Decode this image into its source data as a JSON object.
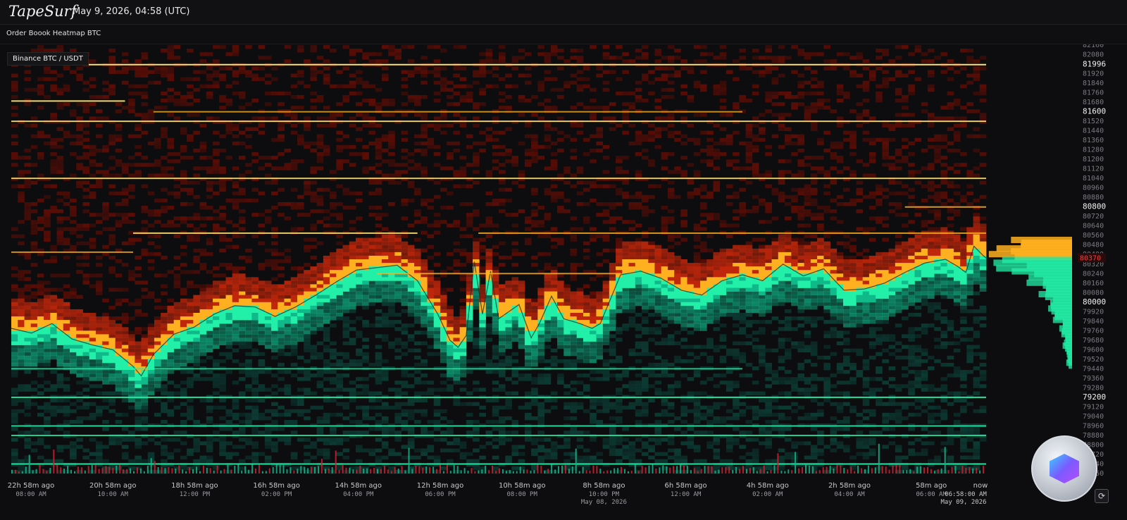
{
  "header": {
    "brand": "TapeSurf",
    "datetime": "May 9, 2026, 04:58 (UTC)"
  },
  "subheader": {
    "title": "Order Boook Heatmap BTC"
  },
  "market_label": "Binance BTC / USDT",
  "icons": {
    "logo": "cube-logo-icon",
    "refresh": "refresh-icon"
  },
  "colors": {
    "background": "#0d0d0f",
    "ask_low": "#5a0d06",
    "ask_mid": "#c0260b",
    "ask_high": "#ffb020",
    "ask_peak": "#ffe070",
    "bid_low": "#0c3b33",
    "bid_mid": "#10b98a",
    "bid_high": "#22f0a8",
    "current_price_marker": "#ff3b3b"
  },
  "chart_data": {
    "type": "heatmap",
    "title": "Order Boook Heatmap BTC",
    "subtitle": "Binance BTC / USDT",
    "y_axis": {
      "ticks": [
        82160,
        82080,
        81996,
        81920,
        81840,
        81760,
        81680,
        81600,
        81520,
        81440,
        81360,
        81280,
        81200,
        81120,
        81040,
        80960,
        80880,
        80800,
        80720,
        80640,
        80560,
        80480,
        80400,
        80320,
        80240,
        80160,
        80080,
        80000,
        79920,
        79840,
        79760,
        79680,
        79600,
        79520,
        79440,
        79360,
        79280,
        79200,
        79120,
        79040,
        78960,
        78880,
        78800,
        78720,
        78640,
        78560
      ],
      "highlighted_ticks": [
        81996,
        81600,
        80800,
        80000,
        79200
      ],
      "current_price_label": "80370",
      "range": [
        78560,
        82160
      ]
    },
    "x_axis": {
      "ticks": [
        {
          "ago": "22h 58m ago",
          "time": "08:00 AM",
          "date": ""
        },
        {
          "ago": "20h 58m ago",
          "time": "10:00 AM",
          "date": ""
        },
        {
          "ago": "18h 58m ago",
          "time": "12:00 PM",
          "date": ""
        },
        {
          "ago": "16h 58m ago",
          "time": "02:00 PM",
          "date": ""
        },
        {
          "ago": "14h 58m ago",
          "time": "04:00 PM",
          "date": ""
        },
        {
          "ago": "12h 58m ago",
          "time": "06:00 PM",
          "date": ""
        },
        {
          "ago": "10h 58m ago",
          "time": "08:00 PM",
          "date": ""
        },
        {
          "ago": "8h 58m ago",
          "time": "10:00 PM",
          "date": "May 08, 2026"
        },
        {
          "ago": "6h 58m ago",
          "time": "12:00 AM",
          "date": ""
        },
        {
          "ago": "4h 58m ago",
          "time": "02:00 AM",
          "date": ""
        },
        {
          "ago": "2h 58m ago",
          "time": "04:00 AM",
          "date": ""
        },
        {
          "ago": "58m ago",
          "time": "06:00 AM",
          "date": ""
        }
      ],
      "now_label": "now",
      "cursor_time": "06:58:00 AM",
      "cursor_date": "May 09, 2026"
    },
    "mid_price_series": [
      {
        "t": -24.0,
        "price": 79780
      },
      {
        "t": -23.5,
        "price": 79740
      },
      {
        "t": -23.0,
        "price": 79820
      },
      {
        "t": -22.5,
        "price": 79690
      },
      {
        "t": -22.0,
        "price": 79640
      },
      {
        "t": -21.5,
        "price": 79600
      },
      {
        "t": -21.0,
        "price": 79460
      },
      {
        "t": -20.8,
        "price": 79380
      },
      {
        "t": -20.5,
        "price": 79560
      },
      {
        "t": -20.0,
        "price": 79730
      },
      {
        "t": -19.5,
        "price": 79790
      },
      {
        "t": -19.0,
        "price": 79900
      },
      {
        "t": -18.5,
        "price": 79970
      },
      {
        "t": -18.0,
        "price": 79960
      },
      {
        "t": -17.5,
        "price": 79880
      },
      {
        "t": -17.0,
        "price": 79960
      },
      {
        "t": -16.5,
        "price": 80060
      },
      {
        "t": -16.0,
        "price": 80170
      },
      {
        "t": -15.5,
        "price": 80270
      },
      {
        "t": -15.0,
        "price": 80290
      },
      {
        "t": -14.5,
        "price": 80310
      },
      {
        "t": -14.0,
        "price": 80180
      },
      {
        "t": -13.5,
        "price": 79900
      },
      {
        "t": -13.2,
        "price": 79680
      },
      {
        "t": -13.0,
        "price": 79620
      },
      {
        "t": -12.8,
        "price": 79720
      },
      {
        "t": -12.6,
        "price": 80340
      },
      {
        "t": -12.4,
        "price": 79900
      },
      {
        "t": -12.2,
        "price": 80260
      },
      {
        "t": -12.0,
        "price": 79860
      },
      {
        "t": -11.5,
        "price": 79980
      },
      {
        "t": -11.2,
        "price": 79700
      },
      {
        "t": -11.0,
        "price": 79820
      },
      {
        "t": -10.7,
        "price": 80050
      },
      {
        "t": -10.4,
        "price": 79860
      },
      {
        "t": -10.0,
        "price": 79820
      },
      {
        "t": -9.7,
        "price": 79780
      },
      {
        "t": -9.5,
        "price": 79820
      },
      {
        "t": -9.0,
        "price": 80230
      },
      {
        "t": -8.5,
        "price": 80260
      },
      {
        "t": -8.0,
        "price": 80200
      },
      {
        "t": -7.5,
        "price": 80100
      },
      {
        "t": -7.0,
        "price": 80060
      },
      {
        "t": -6.5,
        "price": 80180
      },
      {
        "t": -6.0,
        "price": 80230
      },
      {
        "t": -5.5,
        "price": 80180
      },
      {
        "t": -5.0,
        "price": 80320
      },
      {
        "t": -4.5,
        "price": 80220
      },
      {
        "t": -4.0,
        "price": 80280
      },
      {
        "t": -3.5,
        "price": 80100
      },
      {
        "t": -3.0,
        "price": 80110
      },
      {
        "t": -2.5,
        "price": 80160
      },
      {
        "t": -2.0,
        "price": 80250
      },
      {
        "t": -1.5,
        "price": 80330
      },
      {
        "t": -1.0,
        "price": 80360
      },
      {
        "t": -0.7,
        "price": 80300
      },
      {
        "t": -0.5,
        "price": 80250
      },
      {
        "t": -0.3,
        "price": 80470
      },
      {
        "t": -0.1,
        "price": 80400
      },
      {
        "t": 0.0,
        "price": 80370
      }
    ],
    "ask_walls": [
      {
        "price": 81996,
        "start": -24.0,
        "end": 0.0,
        "strength": 1.0
      },
      {
        "price": 81690,
        "start": -24.0,
        "end": -21.2,
        "strength": 0.9
      },
      {
        "price": 81600,
        "start": -20.5,
        "end": -6.0,
        "strength": 0.55
      },
      {
        "price": 81520,
        "start": -24.0,
        "end": 0.0,
        "strength": 0.8
      },
      {
        "price": 81040,
        "start": -24.0,
        "end": 0.0,
        "strength": 0.75
      },
      {
        "price": 80800,
        "start": -2.0,
        "end": 0.0,
        "strength": 0.7
      },
      {
        "price": 80580,
        "start": -21.0,
        "end": -14.0,
        "strength": 0.8
      },
      {
        "price": 80580,
        "start": -12.5,
        "end": 0.0,
        "strength": 0.7
      },
      {
        "price": 80420,
        "start": -24.0,
        "end": -21.0,
        "strength": 0.6
      },
      {
        "price": 80240,
        "start": -15.0,
        "end": -9.0,
        "strength": 0.6
      }
    ],
    "bid_walls": [
      {
        "price": 79200,
        "start": -24.0,
        "end": 0.0,
        "strength": 0.9
      },
      {
        "price": 78960,
        "start": -24.0,
        "end": 0.0,
        "strength": 0.8
      },
      {
        "price": 78880,
        "start": -24.0,
        "end": 0.0,
        "strength": 0.7
      },
      {
        "price": 78640,
        "start": -24.0,
        "end": 0.0,
        "strength": 0.9
      },
      {
        "price": 79440,
        "start": -24.0,
        "end": -6.0,
        "strength": 0.6
      }
    ],
    "depth_profile_side": "right",
    "grid": false
  }
}
